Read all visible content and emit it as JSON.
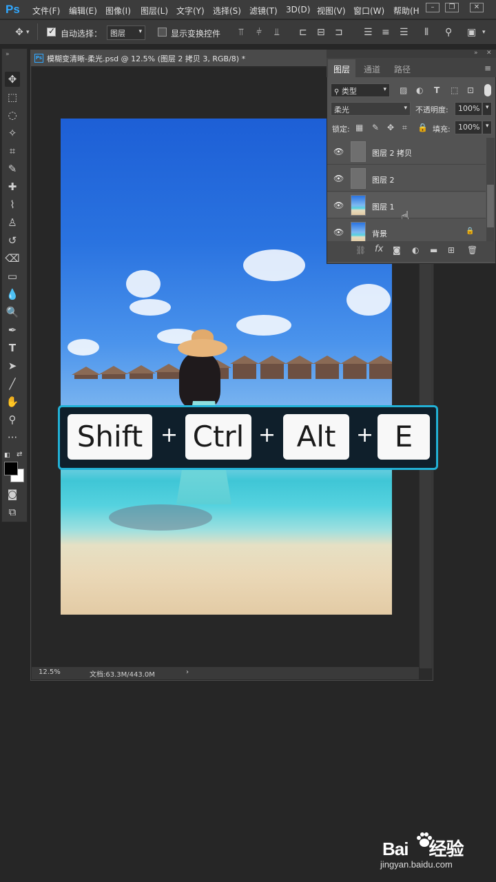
{
  "app": {
    "logo": "Ps"
  },
  "menubar": {
    "items": [
      "文件(F)",
      "编辑(E)",
      "图像(I)",
      "图层(L)",
      "文字(Y)",
      "选择(S)",
      "滤镜(T)",
      "3D(D)",
      "视图(V)",
      "窗口(W)",
      "帮助(H"
    ]
  },
  "optionsbar": {
    "auto_select_label": "自动选择：",
    "auto_select_checked": true,
    "auto_select_target": "图层",
    "show_transform_label": "显示变换控件",
    "show_transform_checked": false
  },
  "document": {
    "title": "模糊变清晰-柔光.psd @ 12.5% (图层 2 拷贝 3, RGB/8) *",
    "zoom": "12.5%",
    "doc_size": "文档:63.3M/443.0M",
    "status_arrow": "›"
  },
  "layers_panel": {
    "tabs": [
      "图层",
      "通道",
      "路径"
    ],
    "active_tab": "图层",
    "filter_kind": "类型",
    "blend_mode": "柔光",
    "opacity_label": "不透明度:",
    "opacity_value": "100%",
    "lock_label": "锁定:",
    "fill_label": "填充:",
    "fill_value": "100%",
    "layers": [
      {
        "name": "图层 2 拷贝",
        "visible": true,
        "thumb": "gray",
        "locked": false
      },
      {
        "name": "图层 2",
        "visible": true,
        "thumb": "gray",
        "locked": false
      },
      {
        "name": "图层 1",
        "visible": true,
        "thumb": "photo",
        "locked": false
      },
      {
        "name": "背景",
        "visible": true,
        "thumb": "photo",
        "locked": true
      }
    ]
  },
  "shortcut_banner": {
    "keys": [
      "Shift",
      "Ctrl",
      "Alt",
      "E"
    ],
    "separator": "+",
    "accent_color": "#22b1d6"
  },
  "watermark": {
    "brand": "Bai",
    "brand_cn": "经验",
    "url": "jingyan.baidu.com"
  }
}
